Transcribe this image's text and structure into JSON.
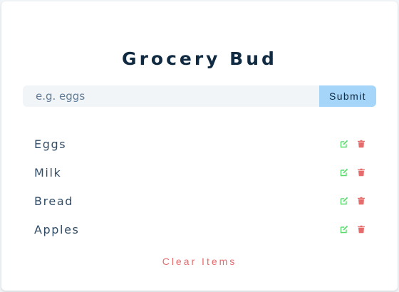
{
  "app": {
    "title": "Grocery Bud"
  },
  "form": {
    "placeholder": "e.g. eggs",
    "value": "",
    "submit_label": "Submit"
  },
  "items": [
    {
      "title": "Eggs",
      "edit_icon": "edit-icon",
      "delete_icon": "trash-icon"
    },
    {
      "title": "Milk",
      "edit_icon": "edit-icon",
      "delete_icon": "trash-icon"
    },
    {
      "title": "Bread",
      "edit_icon": "edit-icon",
      "delete_icon": "trash-icon"
    },
    {
      "title": "Apples",
      "edit_icon": "edit-icon",
      "delete_icon": "trash-icon"
    }
  ],
  "clear_label": "Clear Items",
  "colors": {
    "title": "#102a42",
    "submit_bg": "#a5d5f8",
    "input_bg": "#f1f5f8",
    "edit": "#5ada6e",
    "delete": "#e66b6b",
    "clear": "#e66b6b"
  }
}
